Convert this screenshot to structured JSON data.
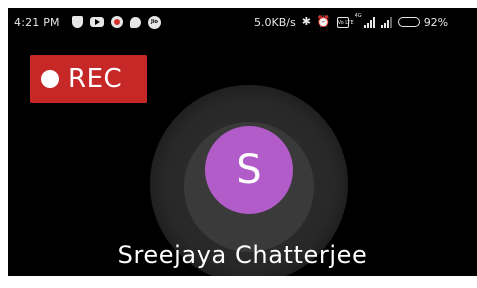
{
  "status_bar": {
    "time": "4:21 PM",
    "notification_icons": [
      "shield-icon",
      "youtube-icon",
      "recorder-app-icon",
      "chat-icon",
      "jio-icon"
    ],
    "jio_text": "Jio",
    "network_speed": "5.0KB/s",
    "volte_label": "Vo LTE",
    "lte_label": "4G",
    "battery_percent": "92%",
    "battery_level": 0.92
  },
  "rec_button": {
    "label": "REC",
    "color": "#c62828"
  },
  "avatar": {
    "initial": "S",
    "color": "#b25cc9"
  },
  "contact": {
    "name": "Sreejaya Chatterjee"
  }
}
